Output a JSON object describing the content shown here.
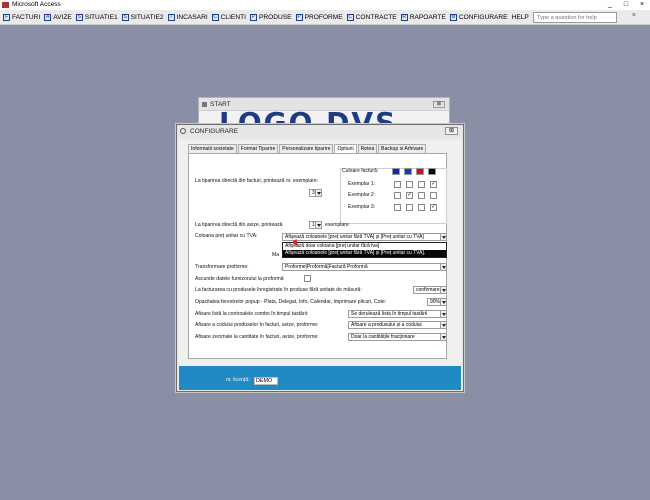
{
  "app": {
    "title": "Microsoft Access"
  },
  "menu": {
    "items": [
      "FACTURI",
      "AVIZE",
      "SITUATIE1",
      "SITUATIE2",
      "INCASARI",
      "CLIENTI",
      "PRODUSE",
      "PROFORME",
      "CONTRACTE",
      "RAPOARTE",
      "CONFIGURARE",
      "HELP"
    ],
    "help_placeholder": "Type a question for help"
  },
  "start_window": {
    "title": "START",
    "logo": "LOGO DVS"
  },
  "config": {
    "title": "CONFIGURARE",
    "tabs": [
      "Informatii societate",
      "Format Tiparire",
      "Personalizare tiparire",
      "Optiuni",
      "Retea",
      "Backup si Arhivare"
    ],
    "active_tab": "Optiuni",
    "facturi_label": "La tiparirea directă din facturi, printează nr. exemplare:",
    "facturi_value": "3",
    "color_group_label": "Culoare factură:",
    "exemplars": [
      "Exemplar 1:",
      "Exemplar 2:",
      "Exemplar 3:"
    ],
    "avize_label": "La tiparirea directă din avize, printează",
    "avize_value": "1",
    "avize_suffix": "exemplare",
    "coloana_label": "Coloana preț unitar cu TVA:",
    "coloana_value": "Afişează coloanele [preț unitar fără TVA] şi [Preț unitar cu TVA]",
    "dropdown_options": [
      "Afişează doar coloana [preț unitar fără tva]",
      "Afişează coloanele [preț unitar fără TVA] şi [Preț unitar cu TVA]."
    ],
    "hidden_fragment": "Ma",
    "transformare_label": "Transformare proforme:",
    "transformare_value": "Proforme|Proformă|Factură Proformă",
    "ascunde_label": "Ascunde datele furnizorului la proformă",
    "facturarea_label": "La facturarea cu produsele înregistrate în produse fără unitate de măsură:",
    "facturarea_value": "confirmare",
    "opacitatea_label": "Opacitatea ferestrelor popup - Plata, Delegat, Info, Calendar, Imprimare plicuri, Cote:",
    "opacitatea_value": "90%",
    "afisare_lista_label": "Afisare listă la controalele combo în timpul tastării:",
    "afisare_lista_value": "Se derulează lista în timpul tastării",
    "afisare_cod_label": "Afisare a codului produselor în facturi, avize, proforme:",
    "afisare_cod_value": "Afisare a produsului și a codului",
    "afisare_zecimale_label": "Afisare zecimale la cantitate în facturi, avize, proforme:",
    "afisare_zecimale_value": "Doar la cantitățile fracționare",
    "licenta_label": "nr. licență:",
    "licenta_value": "DEMO"
  },
  "colors": {
    "blue1": "#0b2aa5",
    "blue2": "#0f3ebf",
    "red": "#d21010",
    "green": "#0a8a20",
    "black": "#000000",
    "footer": "#1f8ac3"
  }
}
